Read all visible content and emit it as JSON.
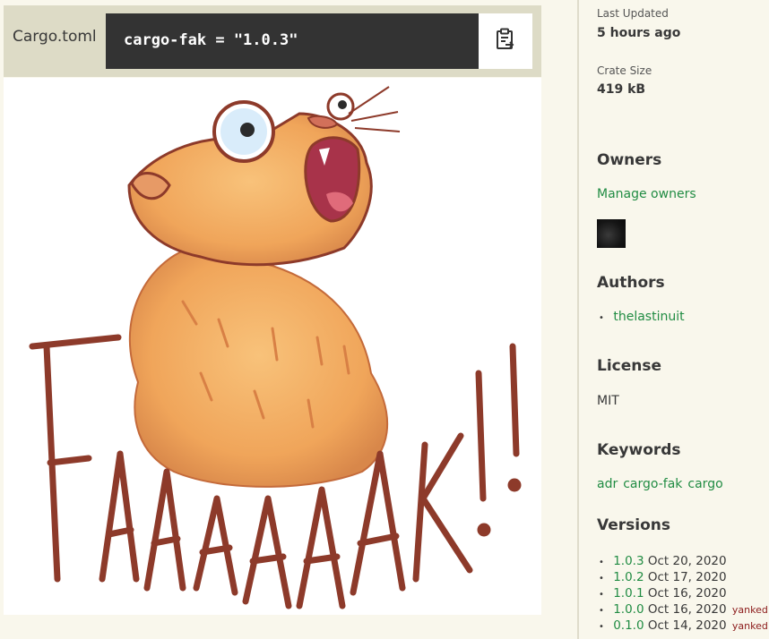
{
  "install": {
    "label": "Cargo.toml",
    "snippet": "cargo-fak = \"1.0.3\""
  },
  "image": {
    "caption": "FAAAAAAK!!"
  },
  "sidebar": {
    "last_updated_label": "Last Updated",
    "last_updated_value": "5 hours ago",
    "crate_size_label": "Crate Size",
    "crate_size_value": "419 kB",
    "owners_title": "Owners",
    "manage_owners": "Manage owners",
    "authors_title": "Authors",
    "authors": [
      "thelastinuit"
    ],
    "license_title": "License",
    "license_value": "MIT",
    "keywords_title": "Keywords",
    "keywords": [
      "adr",
      "cargo-fak",
      "cargo"
    ],
    "versions_title": "Versions",
    "versions": [
      {
        "num": "1.0.3",
        "date": "Oct 20, 2020",
        "yanked": ""
      },
      {
        "num": "1.0.2",
        "date": "Oct 17, 2020",
        "yanked": ""
      },
      {
        "num": "1.0.1",
        "date": "Oct 16, 2020",
        "yanked": ""
      },
      {
        "num": "1.0.0",
        "date": "Oct 16, 2020",
        "yanked": "yanked"
      },
      {
        "num": "0.1.0",
        "date": "Oct 14, 2020",
        "yanked": "yanked"
      }
    ]
  },
  "colors": {
    "accent": "#218c43",
    "yanked": "#8b1a1a",
    "code_bg": "#333333",
    "page_bg": "#f9f7ec"
  }
}
